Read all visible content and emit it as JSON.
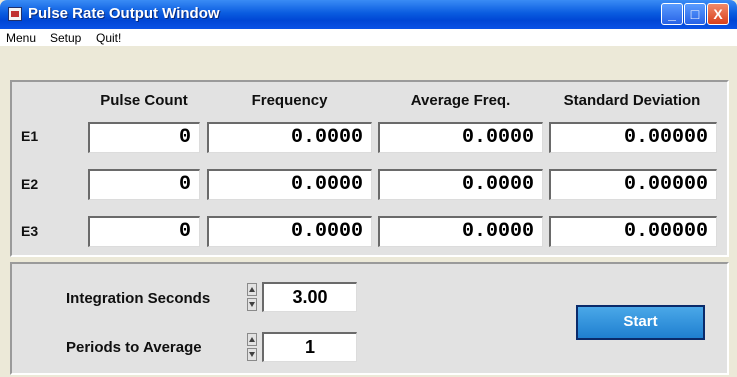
{
  "window": {
    "title": "Pulse Rate Output Window",
    "title_icon": "app-window-icon",
    "controls": {
      "minimize": "_",
      "maximize": "□",
      "close": "X"
    }
  },
  "menu": {
    "items": [
      "Menu",
      "Setup",
      "Quit!"
    ]
  },
  "table": {
    "headers": [
      "Pulse Count",
      "Frequency",
      "Average Freq.",
      "Standard Deviation"
    ],
    "rows": [
      {
        "label": "E1",
        "pulse_count": "0",
        "frequency": "0.0000",
        "average_freq": "0.0000",
        "std_dev": "0.00000"
      },
      {
        "label": "E2",
        "pulse_count": "0",
        "frequency": "0.0000",
        "average_freq": "0.0000",
        "std_dev": "0.00000"
      },
      {
        "label": "E3",
        "pulse_count": "0",
        "frequency": "0.0000",
        "average_freq": "0.0000",
        "std_dev": "0.00000"
      }
    ]
  },
  "controls": {
    "integration_label": "Integration Seconds",
    "integration_value": "3.00",
    "periods_label": "Periods to Average",
    "periods_value": "1",
    "start_label": "Start"
  },
  "colors": {
    "titlebar": "#0a5ce0",
    "panel": "#e2e2e2",
    "start_button": "#2a8ad8"
  }
}
